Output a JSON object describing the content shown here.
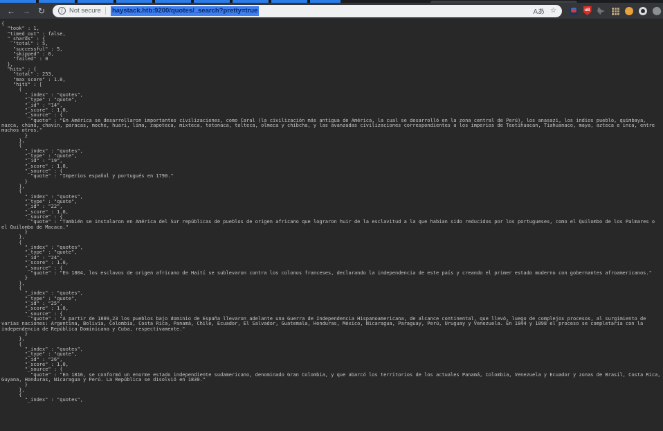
{
  "colors": {
    "selection_blue": "#3d7ef0",
    "tab_strip_blue": "#2b7de9",
    "shield_red": "#d93025",
    "ext_orange": "#e8a33d",
    "page_bg": "#282828",
    "page_text": "#c7c7c7",
    "toolbar_bg": "#35363a"
  },
  "browser": {
    "security_label": "Not secure",
    "url": "haystack.htb:9200/quotes/_search?pretty=true",
    "icons": {
      "back_glyph": "←",
      "forward_glyph": "→",
      "reload_glyph": "↻",
      "info_glyph": "i",
      "translate_glyph": "Aあ",
      "bookmark_glyph": "☆",
      "shield_label": "uB",
      "menu_glyph": "⋮"
    }
  },
  "response": {
    "took": "1",
    "timed_out": "false",
    "shards": {
      "total": "5",
      "successful": "5",
      "skipped": "0",
      "failed": "0"
    },
    "hits_total": "253",
    "max_score": "1.0",
    "hits": [
      {
        "_index": "quotes",
        "_type": "quote",
        "_id": "14",
        "_score": "1.0",
        "quote": "En América se desarrollaron importantes civilizaciones, como Caral (la civilización más antigua de América, la cual se desarrolló en la zona central de Perú), los anasazi, los indios pueblo, quimbaya, nazca, chimú, chavín, paracas, moche, huari, lima, zapoteca, mixteca, totonaca, tolteca, olmeca y chibcha, y las avanzadas civilizaciones correspondientes a los imperios de Teotihuacan, Tiahuanaco, maya, azteca e inca, entre muchos otros."
      },
      {
        "_index": "quotes",
        "_type": "quote",
        "_id": "19",
        "_score": "1.0",
        "quote": "Imperios español y portugués en 1790."
      },
      {
        "_index": "quotes",
        "_type": "quote",
        "_id": "22",
        "_score": "1.0",
        "quote": "También se instalaron en América del Sur repúblicas de pueblos de origen africano que lograron huir de la esclavitud a la que habían sido reducidos por los portugueses, como el Quilombo de los Palmares o el Quilombo de Macaco."
      },
      {
        "_index": "quotes",
        "_type": "quote",
        "_id": "24",
        "_score": "1.0",
        "quote": "En 1804, los esclavos de origen africano de Haití se sublevaron contra los colonos franceses, declarando la independencia de este país y creando el primer estado moderno con gobernantes afroamericanos."
      },
      {
        "_index": "quotes",
        "_type": "quote",
        "_id": "25",
        "_score": "1.0",
        "quote": "A partir de 1809,23 los pueblos bajo dominio de España llevaron adelante una Guerra de Independencia Hispanoamericana, de alcance continental, que llevó, luego de complejos procesos, al surgimiento de varias naciones: Argentina, Bolivia, Colombia, Costa Rica, Panamá, Chile, Ecuador, El Salvador, Guatemala, Honduras, México, Nicaragua, Paraguay, Perú, Uruguay y Venezuela. En 1844 y 1898 el proceso se completaría con la independencia de República Dominicana y Cuba, respectivamente."
      },
      {
        "_index": "quotes",
        "_type": "quote",
        "_id": "26",
        "_score": "1.0",
        "quote": "En 1816, se conformó un enorme estado independiente sudamericano, denominado Gran Colombia, y que abarcó los territorios de los actuales Panamá, Colombia, Venezuela y Ecuador y zonas de Brasil, Costa Rica, Guyana, Honduras, Nicaragua y Perú. La República se disolvió en 1830."
      },
      {
        "_index": "quotes",
        "truncated": true
      }
    ]
  }
}
